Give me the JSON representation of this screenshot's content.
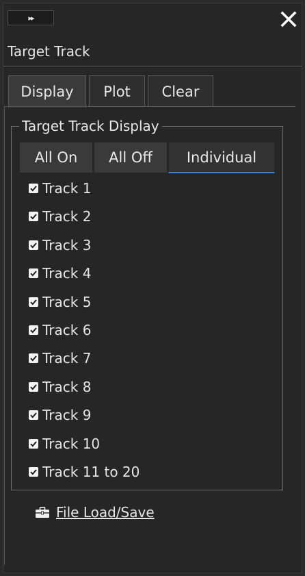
{
  "window": {
    "collapse_glyph": "▸▸",
    "close_icon": "close-icon"
  },
  "header": {
    "title": "Target Track"
  },
  "tabs": [
    {
      "label": "Display",
      "active": true
    },
    {
      "label": "Plot",
      "active": false
    },
    {
      "label": "Clear",
      "active": false
    }
  ],
  "group": {
    "title": "Target Track Display",
    "mode_buttons": [
      {
        "label": "All On",
        "selected": false
      },
      {
        "label": "All Off",
        "selected": false
      },
      {
        "label": "Individual",
        "selected": true
      }
    ],
    "tracks": [
      {
        "label": "Track 1",
        "checked": true
      },
      {
        "label": "Track 2",
        "checked": true
      },
      {
        "label": "Track 3",
        "checked": true
      },
      {
        "label": "Track 4",
        "checked": true
      },
      {
        "label": "Track 5",
        "checked": true
      },
      {
        "label": "Track 6",
        "checked": true
      },
      {
        "label": "Track 7",
        "checked": true
      },
      {
        "label": "Track 8",
        "checked": true
      },
      {
        "label": "Track 9",
        "checked": true
      },
      {
        "label": "Track 10",
        "checked": true
      },
      {
        "label": "Track 11 to 20",
        "checked": true
      }
    ]
  },
  "file": {
    "label": "File Load/Save",
    "icon": "toolbox-icon"
  },
  "colors": {
    "accent": "#3f7fdc",
    "background": "#262626",
    "text": "#e6e6e6"
  }
}
